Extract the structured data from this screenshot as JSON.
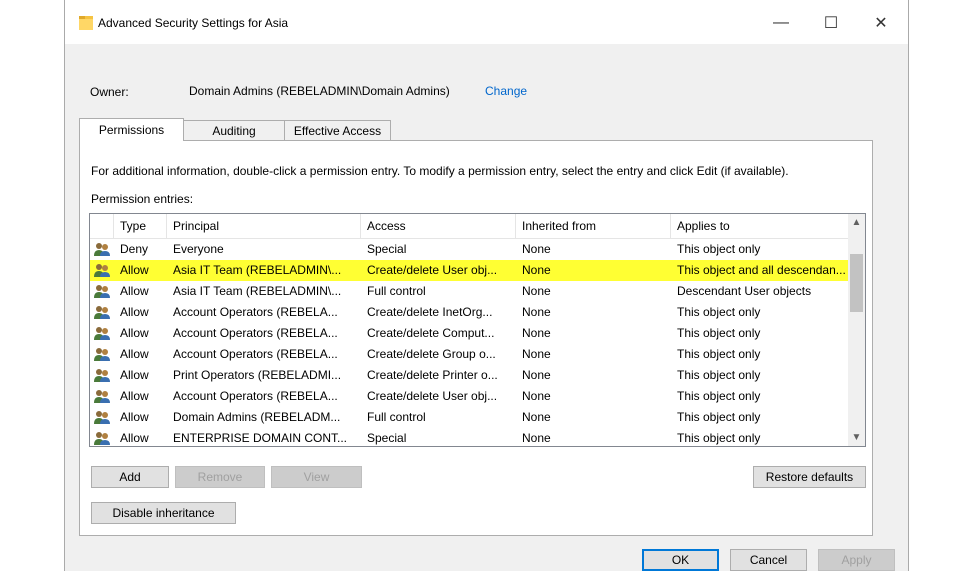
{
  "window": {
    "title": "Advanced Security Settings for Asia",
    "minimize": "—",
    "maximize": "☐",
    "close": "✕"
  },
  "owner": {
    "label": "Owner:",
    "value": "Domain Admins (REBELADMIN\\Domain Admins)",
    "change_link": "Change"
  },
  "tabs": [
    {
      "label": "Permissions",
      "active": true
    },
    {
      "label": "Auditing",
      "active": false
    },
    {
      "label": "Effective Access",
      "active": false
    }
  ],
  "info_text": "For additional information, double-click a permission entry. To modify a permission entry, select the entry and click Edit (if available).",
  "entries_label": "Permission entries:",
  "table": {
    "columns": [
      "Type",
      "Principal",
      "Access",
      "Inherited from",
      "Applies to"
    ],
    "rows": [
      {
        "type": "Deny",
        "principal": "Everyone",
        "access": "Special",
        "inherited": "None",
        "applies": "This object only"
      },
      {
        "type": "Allow",
        "principal": "Asia IT Team (REBELADMIN\\...",
        "access": "Create/delete User obj...",
        "inherited": "None",
        "applies": "This object and all descendan..."
      },
      {
        "type": "Allow",
        "principal": "Asia IT Team (REBELADMIN\\...",
        "access": "Full control",
        "inherited": "None",
        "applies": "Descendant User objects"
      },
      {
        "type": "Allow",
        "principal": "Account Operators (REBELA...",
        "access": "Create/delete InetOrg...",
        "inherited": "None",
        "applies": "This object only"
      },
      {
        "type": "Allow",
        "principal": "Account Operators (REBELA...",
        "access": "Create/delete Comput...",
        "inherited": "None",
        "applies": "This object only"
      },
      {
        "type": "Allow",
        "principal": "Account Operators (REBELA...",
        "access": "Create/delete Group o...",
        "inherited": "None",
        "applies": "This object only"
      },
      {
        "type": "Allow",
        "principal": "Print Operators (REBELADMI...",
        "access": "Create/delete Printer o...",
        "inherited": "None",
        "applies": "This object only"
      },
      {
        "type": "Allow",
        "principal": "Account Operators (REBELA...",
        "access": "Create/delete User obj...",
        "inherited": "None",
        "applies": "This object only"
      },
      {
        "type": "Allow",
        "principal": "Domain Admins (REBELADM...",
        "access": "Full control",
        "inherited": "None",
        "applies": "This object only"
      },
      {
        "type": "Allow",
        "principal": "ENTERPRISE DOMAIN CONT...",
        "access": "Special",
        "inherited": "None",
        "applies": "This object only"
      }
    ],
    "selected_row_index": 1,
    "highlight_color": "#ffff33"
  },
  "buttons": {
    "add": "Add",
    "remove": "Remove",
    "view": "View",
    "restore_defaults": "Restore defaults",
    "disable_inheritance": "Disable inheritance",
    "ok": "OK",
    "cancel": "Cancel",
    "apply": "Apply"
  },
  "colors": {
    "link": "#0066cc",
    "selection": "#ffff33",
    "default_button_border": "#0078d7"
  }
}
